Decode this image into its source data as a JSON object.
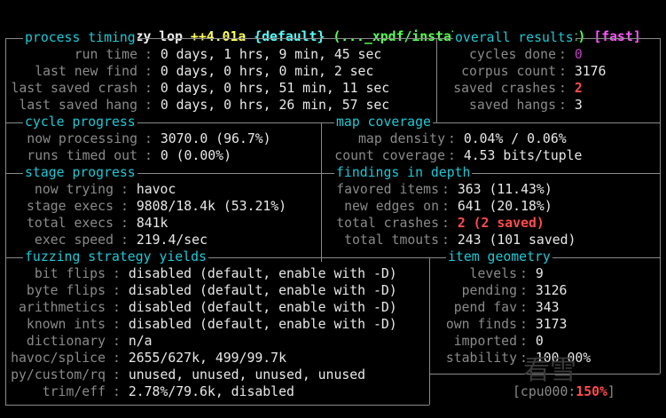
{
  "header": {
    "program": "american fuzzy lop",
    "version": "++4.01a",
    "profile": "{default}",
    "target": "(..._xpdf/install/bin/pdftotext)",
    "mode": "[fast]"
  },
  "process_timing": {
    "title": "process timing",
    "rows": [
      {
        "label": "run time",
        "value": "0 days, 1 hrs, 9 min, 45 sec"
      },
      {
        "label": "last new find",
        "value": "0 days, 0 hrs, 0 min, 2 sec"
      },
      {
        "label": "last saved crash",
        "value": "0 days, 0 hrs, 51 min, 11 sec"
      },
      {
        "label": "last saved hang",
        "value": "0 days, 0 hrs, 26 min, 57 sec"
      }
    ]
  },
  "overall_results": {
    "title": "overall results",
    "rows": [
      {
        "label": "cycles done",
        "value": "0"
      },
      {
        "label": "corpus count",
        "value": "3176"
      },
      {
        "label": "saved crashes",
        "value": "2"
      },
      {
        "label": "saved hangs",
        "value": "3"
      }
    ]
  },
  "cycle_progress": {
    "title": "cycle progress",
    "rows": [
      {
        "label": "now processing",
        "value": "3070.0 (96.7%)"
      },
      {
        "label": "runs timed out",
        "value": "0 (0.00%)"
      }
    ]
  },
  "map_coverage": {
    "title": "map coverage",
    "rows": [
      {
        "label": "map density",
        "value": "0.04% / 0.06%"
      },
      {
        "label": "count coverage",
        "value": "4.53 bits/tuple"
      }
    ]
  },
  "stage_progress": {
    "title": "stage progress",
    "rows": [
      {
        "label": "now trying",
        "value": "havoc"
      },
      {
        "label": "stage execs",
        "value": "9808/18.4k (53.21%)"
      },
      {
        "label": "total execs",
        "value": "841k"
      },
      {
        "label": "exec speed",
        "value": "219.4/sec"
      }
    ]
  },
  "findings_in_depth": {
    "title": "findings in depth",
    "rows": [
      {
        "label": "favored items",
        "value": "363 (11.43%)"
      },
      {
        "label": "new edges on",
        "value": "641 (20.18%)"
      },
      {
        "label": "total crashes",
        "value": "2 (2 saved)"
      },
      {
        "label": "total tmouts",
        "value": "243 (101 saved)"
      }
    ]
  },
  "fuzzing_strategy_yields": {
    "title": "fuzzing strategy yields",
    "rows": [
      {
        "label": "bit flips",
        "value": "disabled (default, enable with -D)"
      },
      {
        "label": "byte flips",
        "value": "disabled (default, enable with -D)"
      },
      {
        "label": "arithmetics",
        "value": "disabled (default, enable with -D)"
      },
      {
        "label": "known ints",
        "value": "disabled (default, enable with -D)"
      },
      {
        "label": "dictionary",
        "value": "n/a"
      },
      {
        "label": "havoc/splice",
        "value": "2655/627k, 499/99.7k"
      },
      {
        "label": "py/custom/rq",
        "value": "unused, unused, unused, unused"
      },
      {
        "label": "trim/eff",
        "value": "2.78%/79.6k, disabled"
      }
    ]
  },
  "item_geometry": {
    "title": "item geometry",
    "rows": [
      {
        "label": "levels",
        "value": "9"
      },
      {
        "label": "pending",
        "value": "3126"
      },
      {
        "label": "pend fav",
        "value": "343"
      },
      {
        "label": "own finds",
        "value": "3173"
      },
      {
        "label": "imported",
        "value": "0"
      },
      {
        "label": "stability",
        "value": "100.00%"
      }
    ]
  },
  "cpu": {
    "prefix": "[cpu000:",
    "value": "150%",
    "suffix": "]"
  },
  "watermark": "看雪",
  "colors": {
    "border": "#8a8a8a",
    "section_title": "#1fc8d6",
    "label": "#8a8a8a",
    "value": "#e8e8e8",
    "crash": "#ff4b4b",
    "header_version": "#ffff55",
    "header_profile": "#55ffff",
    "header_target": "#55ff55",
    "header_mode": "#ff55ff",
    "cycles_done": "#c33ec3"
  }
}
